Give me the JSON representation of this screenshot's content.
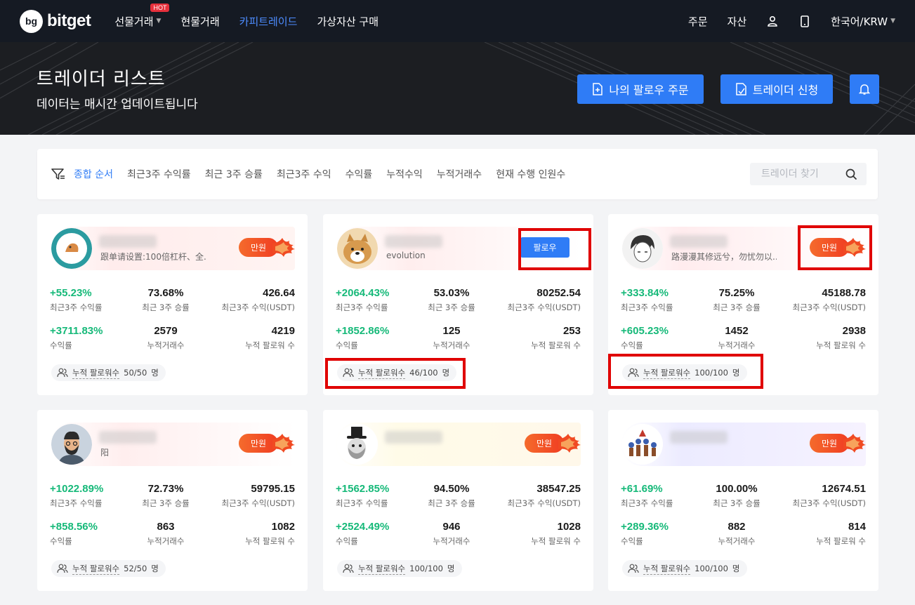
{
  "nav": {
    "logo_mark": "bg",
    "logo_text": "bitget",
    "items": [
      {
        "label": "선물거래",
        "hot": "HOT"
      },
      {
        "label": "현물거래"
      },
      {
        "label": "카피트레이드"
      },
      {
        "label": "가상자산 구매"
      }
    ],
    "right": {
      "orders": "주문",
      "assets": "자산",
      "language": "한국어/KRW"
    }
  },
  "hero": {
    "title": "트레이더 리스트",
    "subtitle": "데이터는 매시간 업데이트됩니다",
    "my_follow_orders": "나의 팔로우 주문",
    "apply_trader": "트레이더 신청"
  },
  "filter": {
    "items": [
      "종합 순서",
      "최근3주 수익률",
      "최근 3주 승률",
      "최근3주 수익",
      "수익률",
      "누적수익",
      "누적거래수",
      "현재 수행 인원수"
    ],
    "search_placeholder": "트레이더 찾기"
  },
  "labels": {
    "roi3w": "최근3주 수익률",
    "win3w": "최근 3주 승률",
    "profit3w": "최근3주 수익(USDT)",
    "roi": "수익률",
    "trades": "누적거래수",
    "followers": "누적 팔로워 수",
    "cum_label": "누적 팔로워수",
    "unit": "명",
    "full": "만원",
    "follow": "팔로우"
  },
  "cards": [
    {
      "desc": "跟单请设置:100倍杠杆、全...",
      "roi3w": "+55.23%",
      "win3w": "73.68%",
      "profit3w": "426.64",
      "roi": "+3711.83%",
      "trades": "2579",
      "followers": "4219",
      "cum": "50/50"
    },
    {
      "desc": "evolution",
      "roi3w": "+2064.43%",
      "win3w": "53.03%",
      "profit3w": "80252.54",
      "roi": "+1852.86%",
      "trades": "125",
      "followers": "253",
      "cum": "46/100"
    },
    {
      "desc": "路漫漫其修远兮，勿忧勿以...",
      "roi3w": "+333.84%",
      "win3w": "75.25%",
      "profit3w": "45188.78",
      "roi": "+605.23%",
      "trades": "1452",
      "followers": "2938",
      "cum": "100/100"
    },
    {
      "desc": "阳",
      "roi3w": "+1022.89%",
      "win3w": "72.73%",
      "profit3w": "59795.15",
      "roi": "+858.56%",
      "trades": "863",
      "followers": "1082",
      "cum": "52/50"
    },
    {
      "desc": "",
      "roi3w": "+1562.85%",
      "win3w": "94.50%",
      "profit3w": "38547.25",
      "roi": "+2524.49%",
      "trades": "946",
      "followers": "1028",
      "cum": "100/100"
    },
    {
      "desc": "",
      "roi3w": "+61.69%",
      "win3w": "100.00%",
      "profit3w": "12674.51",
      "roi": "+289.36%",
      "trades": "882",
      "followers": "814",
      "cum": "100/100"
    }
  ],
  "colors": {
    "accent": "#2f7cf6",
    "green": "#16b979",
    "flame": "#f04a22",
    "annotation": "#e00000"
  }
}
